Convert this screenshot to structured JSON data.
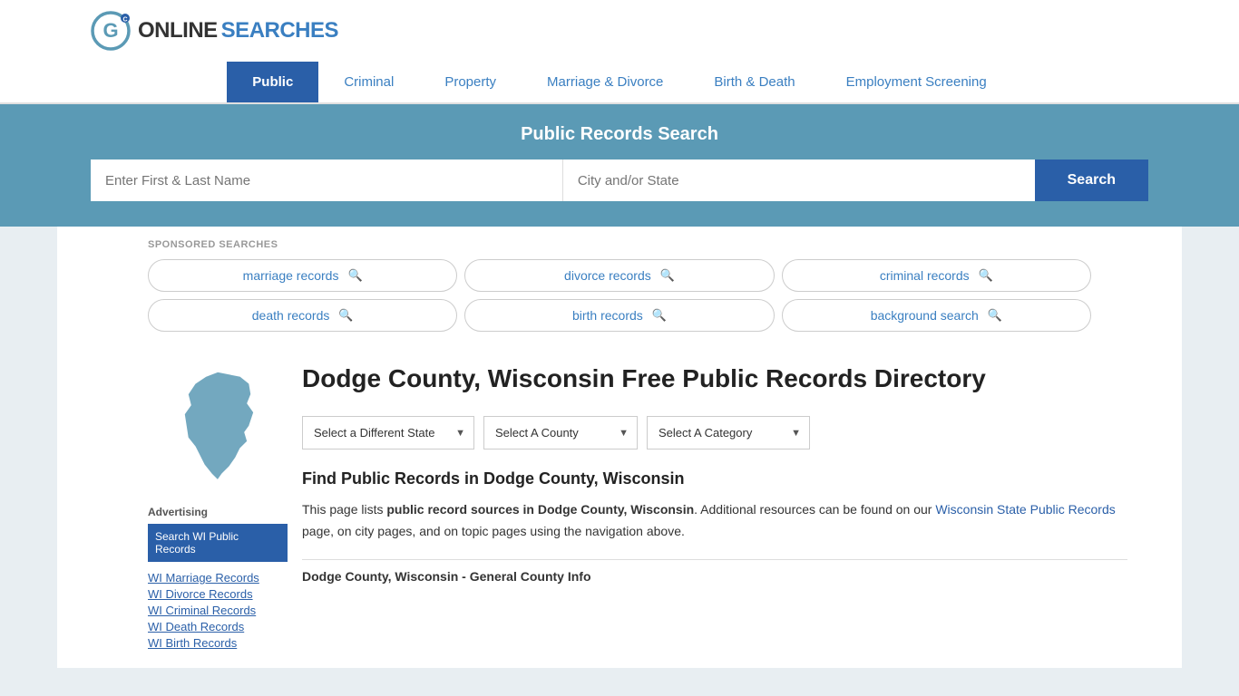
{
  "logo": {
    "text_online": "ONLINE",
    "text_searches": "SEARCHES"
  },
  "nav": {
    "items": [
      {
        "label": "Public",
        "active": true
      },
      {
        "label": "Criminal",
        "active": false
      },
      {
        "label": "Property",
        "active": false
      },
      {
        "label": "Marriage & Divorce",
        "active": false
      },
      {
        "label": "Birth & Death",
        "active": false
      },
      {
        "label": "Employment Screening",
        "active": false
      }
    ]
  },
  "banner": {
    "title": "Public Records Search",
    "name_placeholder": "Enter First & Last Name",
    "location_placeholder": "City and/or State",
    "search_label": "Search"
  },
  "sponsored": {
    "label": "SPONSORED SEARCHES",
    "tags": [
      {
        "text": "marriage records"
      },
      {
        "text": "divorce records"
      },
      {
        "text": "criminal records"
      },
      {
        "text": "death records"
      },
      {
        "text": "birth records"
      },
      {
        "text": "background search"
      }
    ]
  },
  "sidebar": {
    "ad_label": "Advertising",
    "ad_button": "Search WI Public Records",
    "links": [
      {
        "text": "WI Marriage Records"
      },
      {
        "text": "WI Divorce Records"
      },
      {
        "text": "WI Criminal Records"
      },
      {
        "text": "WI Death Records"
      },
      {
        "text": "WI Birth Records"
      }
    ]
  },
  "county": {
    "title": "Dodge County, Wisconsin Free Public Records Directory",
    "dropdown_state": "Select a Different State",
    "dropdown_county": "Select A County",
    "dropdown_category": "Select A Category",
    "find_title": "Find Public Records in Dodge County, Wisconsin",
    "find_desc_1": "This page lists ",
    "find_desc_bold": "public record sources in Dodge County, Wisconsin",
    "find_desc_2": ". Additional resources can be found on our ",
    "find_link": "Wisconsin State Public Records",
    "find_desc_3": " page, on city pages, and on topic pages using the navigation above.",
    "general_info": "Dodge County, Wisconsin - General County Info"
  }
}
